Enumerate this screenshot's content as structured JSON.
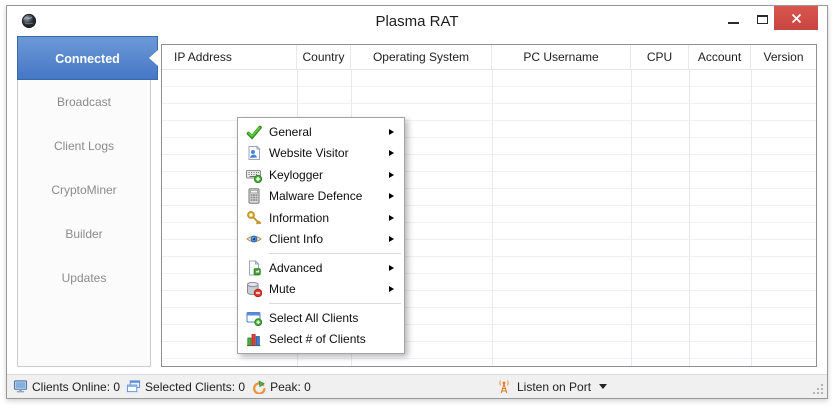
{
  "window": {
    "title": "Plasma RAT"
  },
  "titlebar": {
    "close_glyph": "✕",
    "icons": [
      "globe-icon",
      "minimize-icon",
      "maximize-icon",
      "close-icon"
    ]
  },
  "sidebar": {
    "items": [
      {
        "label": "Connected",
        "selected": true
      },
      {
        "label": "Broadcast",
        "selected": false
      },
      {
        "label": "Client Logs",
        "selected": false
      },
      {
        "label": "CryptoMiner",
        "selected": false
      },
      {
        "label": "Builder",
        "selected": false
      },
      {
        "label": "Updates",
        "selected": false
      }
    ]
  },
  "table": {
    "columns": [
      {
        "label": "IP Address"
      },
      {
        "label": "Country"
      },
      {
        "label": "Operating System"
      },
      {
        "label": "PC Username"
      },
      {
        "label": "CPU"
      },
      {
        "label": "Account"
      },
      {
        "label": "Version"
      }
    ],
    "rows": []
  },
  "context_menu": {
    "items": [
      {
        "label": "General",
        "icon": "checkmark-icon",
        "submenu": true
      },
      {
        "label": "Website Visitor",
        "icon": "website-visitor-icon",
        "submenu": true
      },
      {
        "label": "Keylogger",
        "icon": "keyboard-add-icon",
        "submenu": true
      },
      {
        "label": "Malware Defence",
        "icon": "calculator-icon",
        "submenu": true
      },
      {
        "label": "Information",
        "icon": "key-icon",
        "submenu": true
      },
      {
        "label": "Client Info",
        "icon": "eye-icon",
        "submenu": true
      },
      {
        "separator": true
      },
      {
        "label": "Advanced",
        "icon": "document-icon",
        "submenu": true
      },
      {
        "label": "Mute",
        "icon": "database-mute-icon",
        "submenu": true
      },
      {
        "separator": true
      },
      {
        "label": "Select All Clients",
        "icon": "window-add-icon",
        "submenu": false
      },
      {
        "label": "Select # of Clients",
        "icon": "bar-chart-icon",
        "submenu": false
      }
    ]
  },
  "statusbar": {
    "clients_online": "Clients Online: 0",
    "selected_clients": "Selected Clients: 0",
    "peak": "Peak: 0",
    "listen_on_port": "Listen on Port",
    "icons": [
      "monitor-icon",
      "windows-stack-icon",
      "peak-arrow-icon",
      "antenna-icon",
      "dropdown-arrow-icon",
      "resize-grip"
    ]
  },
  "colors": {
    "selected_tab_blue": "#4577c6",
    "close_red": "#cc4a44",
    "grid_line": "#edf1f7",
    "statusbar_bg": "#f0f0f0",
    "sidebar_text": "#8b8b8b"
  }
}
